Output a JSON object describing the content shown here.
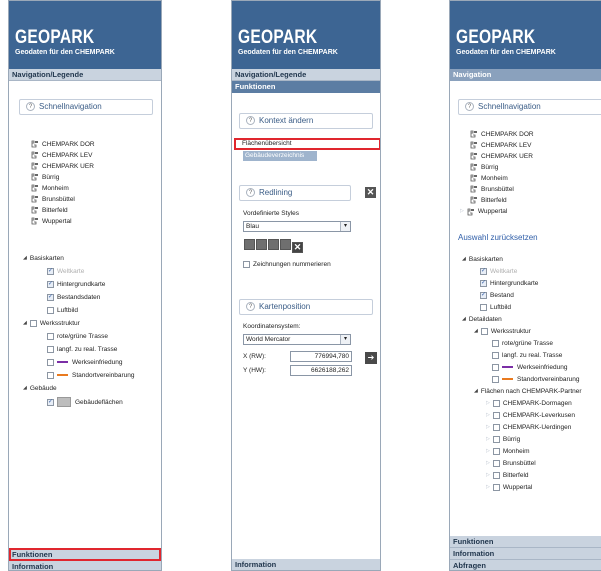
{
  "brand": {
    "title": "GEOPARK",
    "subtitle": "Geodaten für den CHEMPARK"
  },
  "panel1": {
    "nav_header": "Navigation/Legende",
    "quicknav": "Schnellnavigation",
    "help": "?",
    "locations": [
      "CHEMPARK DOR",
      "CHEMPARK LEV",
      "CHEMPARK UER",
      "Bürrig",
      "Monheim",
      "Brunsbüttel",
      "Bitterfeld",
      "Wuppertal"
    ],
    "basiskarten": "Basiskarten",
    "base_items": [
      "Weltkarte",
      "Hintergrundkarte",
      "Bestandsdaten",
      "Luftbild"
    ],
    "werksstruktur": "Werksstruktur",
    "ws_items": [
      "rote/grüne Trasse",
      "langf. zu real. Trasse",
      "Werkseinfriedung",
      "Standortvereinbarung"
    ],
    "gebaude": "Gebäude",
    "gebaude_item": "Gebäudeflächen",
    "funktionen": "Funktionen",
    "information": "Information"
  },
  "panel2": {
    "nav_header": "Navigation/Legende",
    "funktionen": "Funktionen",
    "kontext": "Kontext ändern",
    "flachen": "Flächenübersicht",
    "gebaudeverz": "Gebäudeverzeichnis",
    "redlining": "Redlining",
    "styles_label": "Vordefinierte Styles",
    "style_value": "Blau",
    "number_label": "Zeichnungen nummerieren",
    "kartenposition": "Kartenposition",
    "coord_label": "Koordinatensystem:",
    "coord_value": "World Mercator",
    "x_label": "X (RW):",
    "x_value": "776994,780",
    "y_label": "Y (HW):",
    "y_value": "6626188,262",
    "information": "Information"
  },
  "panel3": {
    "nav_header": "Navigation",
    "quicknav": "Schnellnavigation",
    "locations": [
      "CHEMPARK DOR",
      "CHEMPARK LEV",
      "CHEMPARK UER",
      "Bürrig",
      "Monheim",
      "Brunsbüttel",
      "Bitterfeld",
      "Wuppertal"
    ],
    "reset": "Auswahl zurücksetzen",
    "basiskarten": "Basiskarten",
    "base_items": [
      "Weltkarte",
      "Hintergrundkarte",
      "Bestand",
      "Luftbild"
    ],
    "detaildaten": "Detaildaten",
    "werksstruktur": "Werksstruktur",
    "ws_items": [
      "rote/grüne Trasse",
      "langf. zu real. Trasse",
      "Werkseinfriedung",
      "Standortvereinbarung"
    ],
    "partner": "Flächen nach CHEMPARK-Partner",
    "partner_items": [
      "CHEMPARK-Dormagen",
      "CHEMPARK-Leverkusen",
      "CHEMPARK-Uerdingen",
      "Bürrig",
      "Monheim",
      "Brunsbüttel",
      "Bitterfeld",
      "Wuppertal"
    ],
    "funktionen": "Funktionen",
    "information": "Information",
    "abfragen": "Abfragen"
  },
  "colors": {
    "brand": "#3d6593",
    "header_light": "#c9d3df",
    "highlight": "#e0262e",
    "purple": "#7b2fa6",
    "orange": "#e97a1f"
  }
}
